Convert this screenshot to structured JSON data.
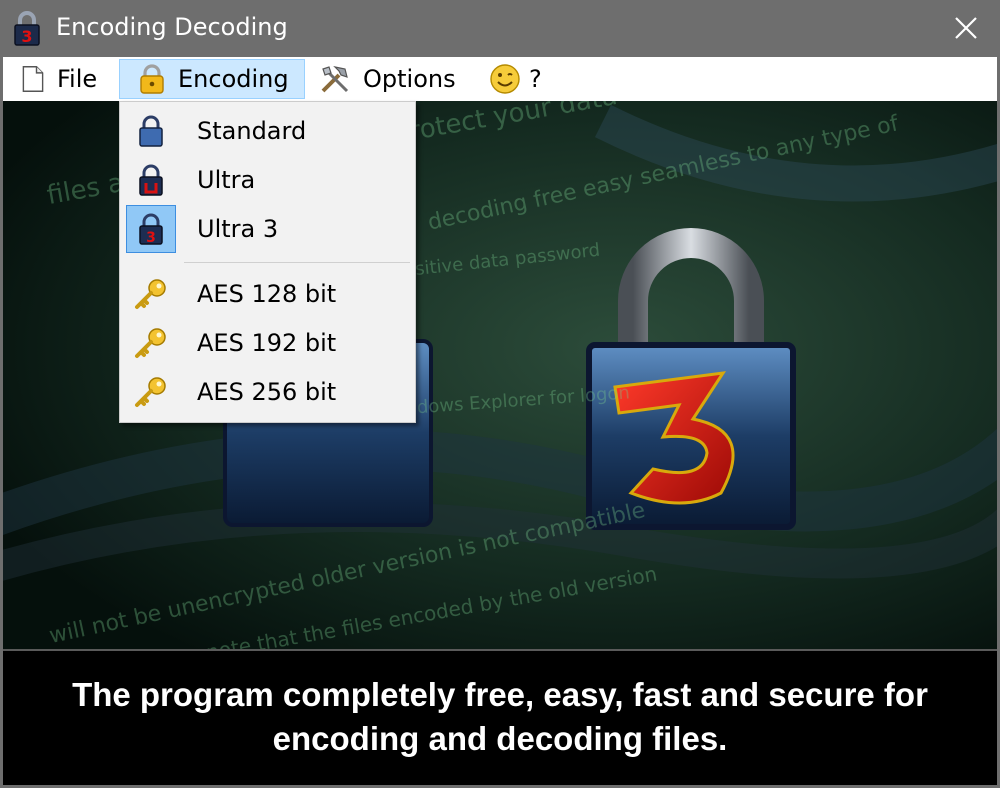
{
  "window": {
    "title": "Encoding Decoding"
  },
  "menubar": {
    "items": [
      {
        "label": "File",
        "icon": "document-icon"
      },
      {
        "label": "Encoding",
        "icon": "lock-icon"
      },
      {
        "label": "Options",
        "icon": "tools-icon"
      },
      {
        "label": "?",
        "icon": "smiley-icon"
      }
    ]
  },
  "dropdown": {
    "items": [
      {
        "label": "Standard",
        "icon": "blue-lock-icon"
      },
      {
        "label": "Ultra",
        "icon": "red-lock-icon"
      },
      {
        "label": "Ultra 3",
        "icon": "lock-3-icon",
        "checked": true
      },
      {
        "label": "AES 128 bit",
        "icon": "key-icon"
      },
      {
        "label": "AES 192 bit",
        "icon": "key-icon"
      },
      {
        "label": "AES 256 bit",
        "icon": "key-icon"
      }
    ]
  },
  "footer": {
    "line1": "The program completely free, easy, fast and secure for",
    "line2": "encoding and decoding files."
  },
  "colors": {
    "menu_highlight": "#cce8ff",
    "checked_icon_bg": "#90c8f6",
    "footer_bg": "#000000"
  }
}
